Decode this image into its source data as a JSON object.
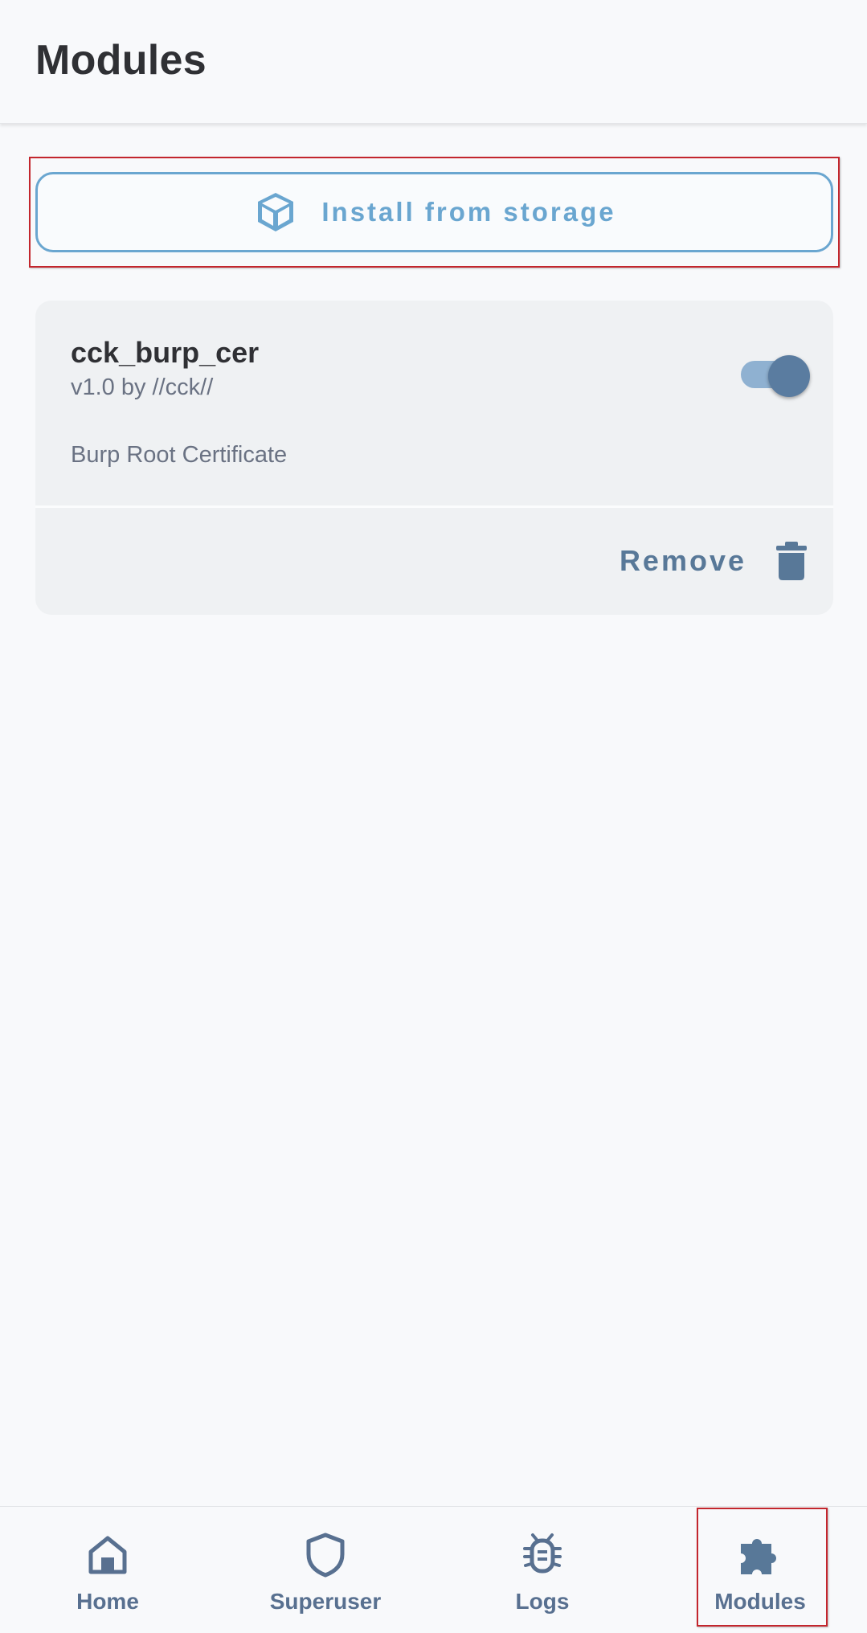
{
  "app_bar": {
    "title": "Modules"
  },
  "install": {
    "label": "Install from storage",
    "icon": "box-icon"
  },
  "modules": [
    {
      "name": "cck_burp_cer",
      "version_author": "v1.0 by //cck//",
      "description": "Burp Root Certificate",
      "enabled": true,
      "remove_label": "Remove",
      "remove_icon": "trash-icon"
    }
  ],
  "bottom_nav": {
    "items": [
      {
        "label": "Home",
        "icon": "home-icon",
        "selected": false
      },
      {
        "label": "Superuser",
        "icon": "shield-icon",
        "selected": false
      },
      {
        "label": "Logs",
        "icon": "bug-icon",
        "selected": false
      },
      {
        "label": "Modules",
        "icon": "puzzle-icon",
        "selected": true
      }
    ]
  },
  "colors": {
    "accent": "#6aa6d0",
    "primary": "#587898",
    "card_bg": "#eff1f3",
    "highlight": "#c3262d"
  }
}
